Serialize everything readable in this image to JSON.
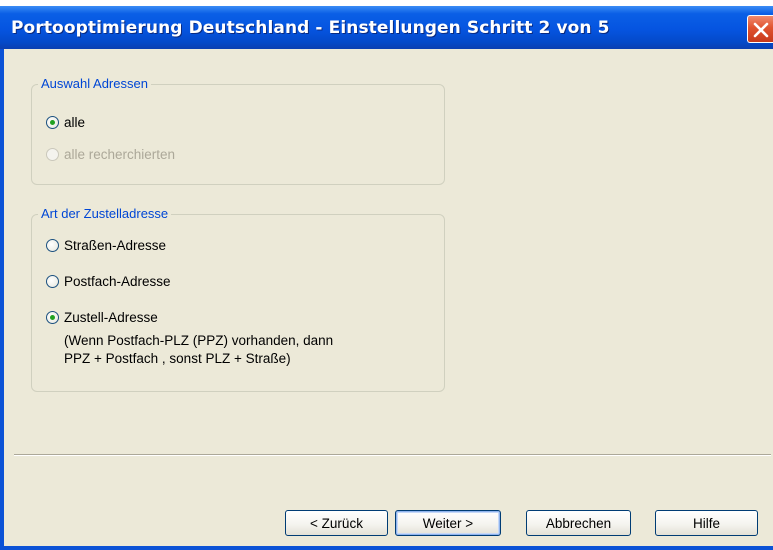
{
  "window": {
    "title": "Portooptimierung Deutschland - Einstellungen Schritt 2 von 5"
  },
  "group_addresses": {
    "legend": "Auswahl Adressen",
    "options": [
      {
        "label": "alle",
        "checked": true,
        "disabled": false
      },
      {
        "label": "alle recherchierten",
        "checked": false,
        "disabled": true
      }
    ]
  },
  "group_delivery": {
    "legend": "Art der Zustelladresse",
    "options": [
      {
        "label": "Straßen-Adresse",
        "checked": false
      },
      {
        "label": "Postfach-Adresse",
        "checked": false
      },
      {
        "label": "Zustell-Adresse",
        "checked": true
      }
    ],
    "hint_line1": "(Wenn Postfach-PLZ (PPZ) vorhanden, dann",
    "hint_line2": "PPZ + Postfach , sonst PLZ + Straße)"
  },
  "buttons": {
    "back": "< Zurück",
    "next": "Weiter >",
    "cancel": "Abbrechen",
    "help": "Hilfe"
  },
  "colors": {
    "title_bar": "#0554e0",
    "dialog_background": "#ece9d8",
    "group_legend": "#0046d5",
    "radio_selected_dot": "#21a121",
    "close_button": "#e0532f"
  },
  "icons": {
    "close": "close-icon"
  }
}
